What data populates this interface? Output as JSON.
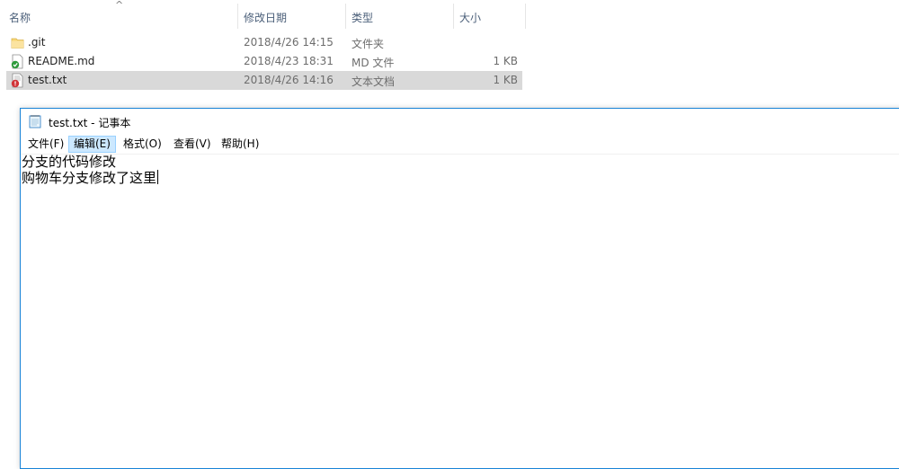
{
  "explorer": {
    "columns": {
      "name": "名称",
      "date": "修改日期",
      "type": "类型",
      "size": "大小"
    },
    "sort_icon": "chevron-up-icon",
    "files": [
      {
        "name": ".git",
        "date": "2018/4/26 14:15",
        "type": "文件夹",
        "size": "",
        "icon": "folder-icon"
      },
      {
        "name": "README.md",
        "date": "2018/4/23 18:31",
        "type": "MD 文件",
        "size": "1 KB",
        "icon": "md-file-check-icon"
      },
      {
        "name": "test.txt",
        "date": "2018/4/26 14:16",
        "type": "文本文档",
        "size": "1 KB",
        "icon": "txt-file-conflict-icon"
      }
    ],
    "selected_index": 2
  },
  "notepad": {
    "title": "test.txt - 记事本",
    "icon": "notepad-icon",
    "menu": [
      "文件(F)",
      "编辑(E)",
      "格式(O)",
      "查看(V)",
      "帮助(H)"
    ],
    "active_menu_index": 1,
    "lines": [
      "分支的代码修改",
      "购物车分支修改了这里"
    ]
  }
}
